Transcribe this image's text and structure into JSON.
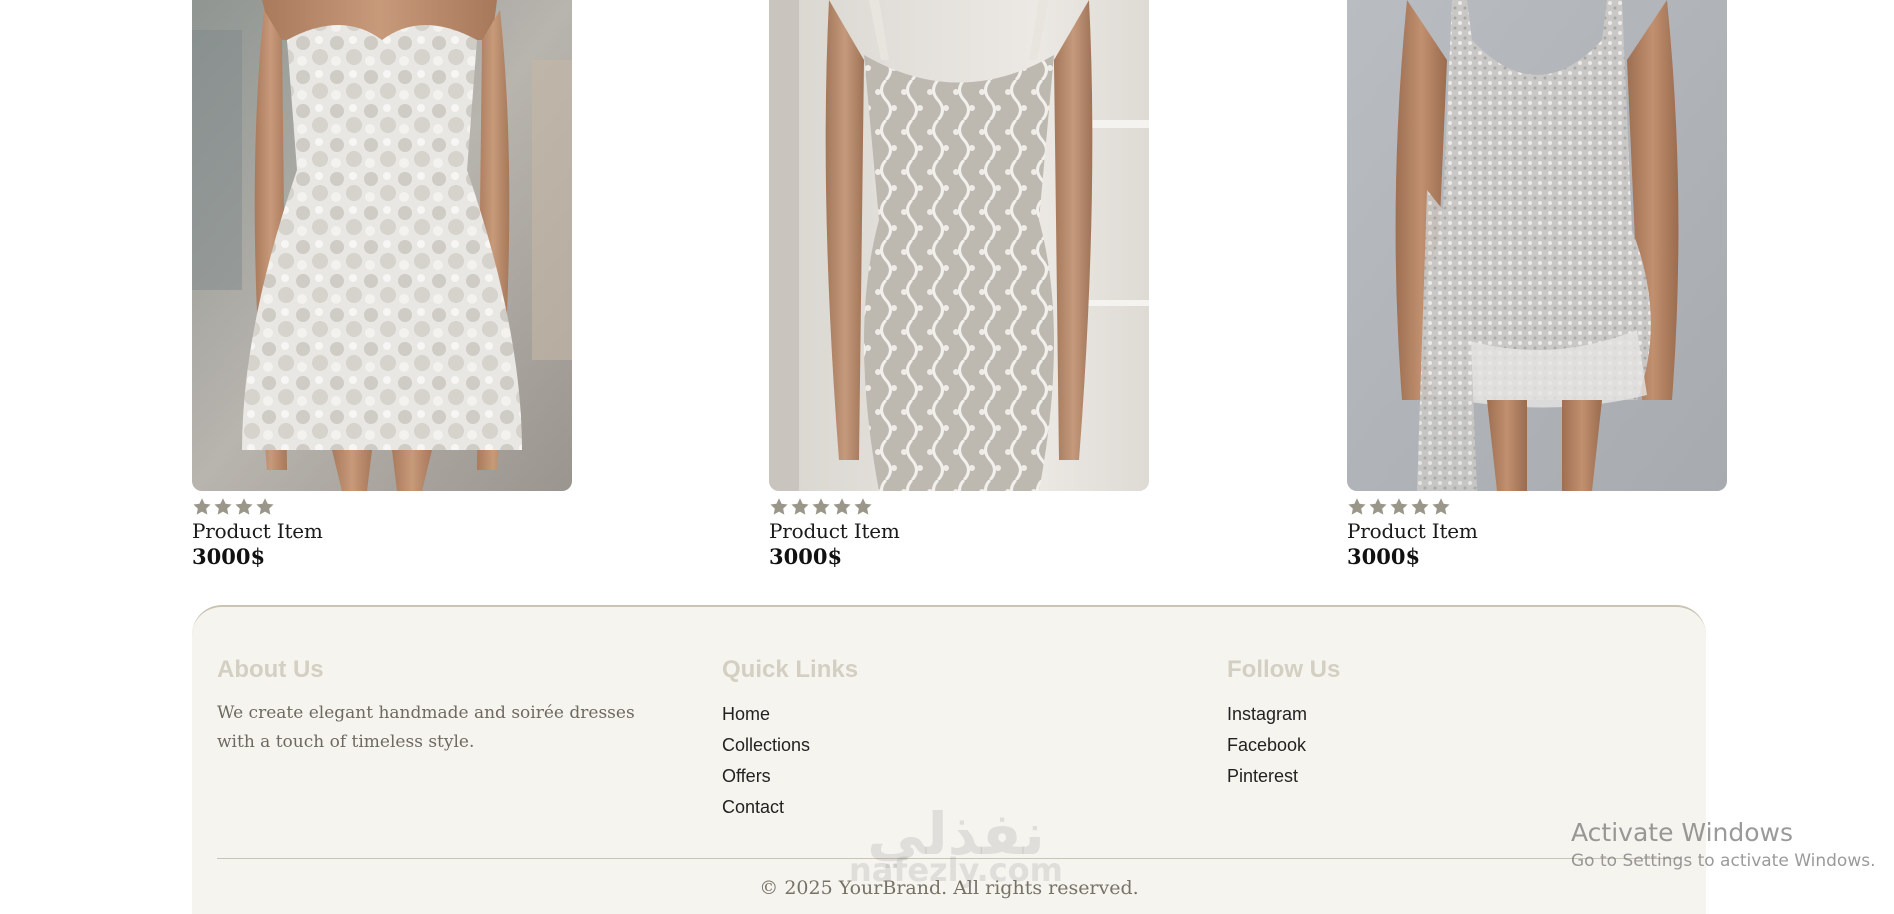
{
  "products": [
    {
      "name": "Product Item",
      "price": "3000$",
      "rating": 4,
      "image": "white floral lace strapless mini dress"
    },
    {
      "name": "Product Item",
      "price": "3000$",
      "rating": 5,
      "image": "ivory lace fitted mermaid dress"
    },
    {
      "name": "Product Item",
      "price": "3000$",
      "rating": 5,
      "image": "silver beaded draped mini dress"
    }
  ],
  "footer": {
    "about": {
      "heading": "About Us",
      "text": "We create elegant handmade and soirée dresses with a touch of timeless style."
    },
    "quick_links": {
      "heading": "Quick Links",
      "items": [
        "Home",
        "Collections",
        "Offers",
        "Contact"
      ]
    },
    "follow": {
      "heading": "Follow Us",
      "items": [
        "Instagram",
        "Facebook",
        "Pinterest"
      ]
    },
    "copyright": "© 2025 YourBrand. All rights reserved."
  },
  "watermark": {
    "arabic": "نفذلي",
    "latin": "nafezly.com"
  },
  "os_overlay": {
    "title": "Activate Windows",
    "subtitle": "Go to Settings to activate Windows."
  },
  "colors": {
    "star": "#9a978a",
    "footer_bg": "#f6f4ef",
    "footer_heading": "#d3cfc2",
    "footer_border": "#c9c4b3"
  }
}
